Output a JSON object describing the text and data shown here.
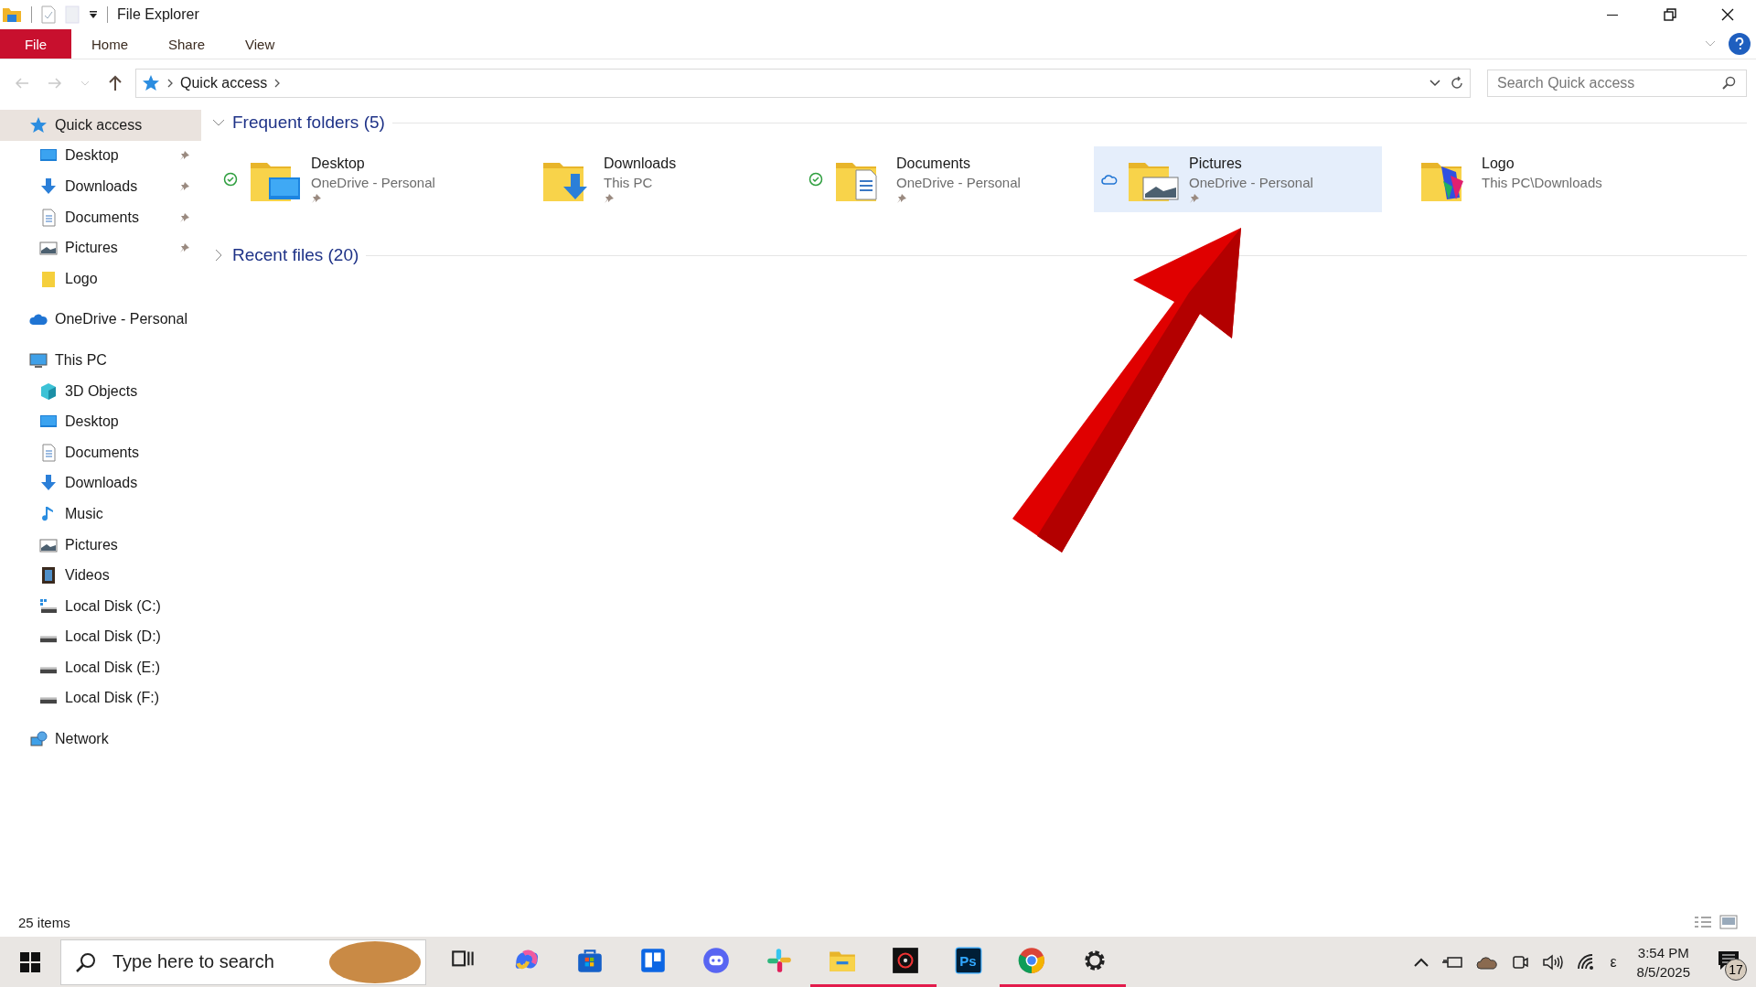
{
  "window": {
    "title": "File Explorer"
  },
  "ribbon_tabs": [
    {
      "label": "File",
      "selected": true
    },
    {
      "label": "Home",
      "selected": false
    },
    {
      "label": "Share",
      "selected": false
    },
    {
      "label": "View",
      "selected": false
    }
  ],
  "address_bar": {
    "path": "Quick access"
  },
  "search": {
    "placeholder": "Search Quick access"
  },
  "sidebar": {
    "items": [
      {
        "label": "Quick access",
        "kind": "star",
        "selected": true,
        "children": [
          {
            "label": "Desktop",
            "kind": "desktop",
            "pinned": true,
            "selected": false
          },
          {
            "label": "Downloads",
            "kind": "download",
            "pinned": true,
            "selected": false
          },
          {
            "label": "Documents",
            "kind": "document",
            "pinned": true,
            "selected": false
          },
          {
            "label": "Pictures",
            "kind": "picture",
            "pinned": true,
            "selected": false
          },
          {
            "label": "Logo",
            "kind": "folder",
            "pinned": false,
            "selected": false
          }
        ]
      },
      {
        "label": "OneDrive - Personal",
        "kind": "cloud",
        "selected": false
      },
      {
        "label": "This PC",
        "kind": "pc",
        "selected": false,
        "children": [
          {
            "label": "3D Objects",
            "kind": "cube",
            "selected": false
          },
          {
            "label": "Desktop",
            "kind": "desktop",
            "selected": false
          },
          {
            "label": "Documents",
            "kind": "document",
            "selected": false
          },
          {
            "label": "Downloads",
            "kind": "download",
            "selected": false
          },
          {
            "label": "Music",
            "kind": "music",
            "selected": false
          },
          {
            "label": "Pictures",
            "kind": "picture",
            "selected": false
          },
          {
            "label": "Videos",
            "kind": "video",
            "selected": false
          },
          {
            "label": "Local Disk (C:)",
            "kind": "systemdisk",
            "selected": false
          },
          {
            "label": "Local Disk (D:)",
            "kind": "disk",
            "selected": false
          },
          {
            "label": "Local Disk (E:)",
            "kind": "disk",
            "selected": false
          },
          {
            "label": "Local Disk (F:)",
            "kind": "disk",
            "selected": false
          }
        ]
      },
      {
        "label": "Network",
        "kind": "network",
        "selected": false
      }
    ]
  },
  "sections": [
    {
      "title": "Frequent folders (5)",
      "expanded": true,
      "folders": [
        {
          "name": "Desktop",
          "location": "OneDrive - Personal",
          "kind": "desktop",
          "synced": true,
          "cloud_only": false,
          "pinned": true,
          "selected": false
        },
        {
          "name": "Downloads",
          "location": "This PC",
          "kind": "download",
          "synced": false,
          "cloud_only": false,
          "pinned": true,
          "selected": false
        },
        {
          "name": "Documents",
          "location": "OneDrive - Personal",
          "kind": "document",
          "synced": true,
          "cloud_only": false,
          "pinned": true,
          "selected": false
        },
        {
          "name": "Pictures",
          "location": "OneDrive - Personal",
          "kind": "picture",
          "synced": false,
          "cloud_only": true,
          "pinned": true,
          "selected": true
        },
        {
          "name": "Logo",
          "location": "This PC\\Downloads",
          "kind": "logo",
          "synced": false,
          "cloud_only": false,
          "pinned": false,
          "selected": false
        }
      ]
    },
    {
      "title": "Recent files (20)",
      "expanded": false
    }
  ],
  "status_bar": {
    "count": "25 items"
  },
  "taskbar": {
    "search_placeholder": "Type here to search",
    "apps": [
      {
        "kind": "taskview",
        "running": false
      },
      {
        "kind": "swirl",
        "running": false
      },
      {
        "kind": "bag",
        "running": false
      },
      {
        "kind": "board",
        "running": false
      },
      {
        "kind": "chat",
        "running": false
      },
      {
        "kind": "hash",
        "running": false
      },
      {
        "kind": "explorer",
        "running": true
      },
      {
        "kind": "disc",
        "running": true
      },
      {
        "kind": "ps",
        "label": "Ps",
        "running": false
      },
      {
        "kind": "browser",
        "running": true
      },
      {
        "kind": "gear",
        "running": true
      }
    ],
    "tray": {
      "language": "ε",
      "time": "3:54 PM",
      "date": "8/5/2025",
      "notifications": "17"
    }
  }
}
